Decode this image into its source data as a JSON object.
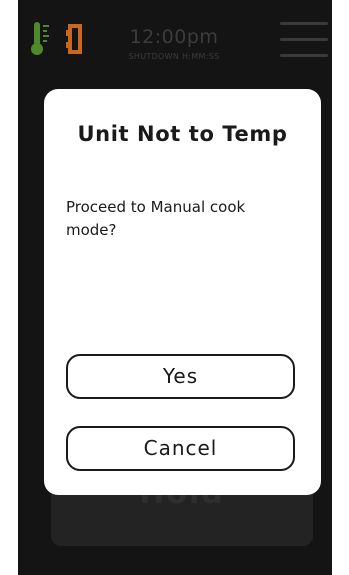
{
  "status_bar": {
    "time": "12:00pm",
    "shutdown_label": "SHUTDOWN H:MM:SS",
    "icons": {
      "temperature": "thermometer-icon",
      "door": "door-icon",
      "menu": "hamburger-menu-icon"
    }
  },
  "background_panel": {
    "label": "Hold"
  },
  "dialog": {
    "title": "Unit Not to Temp",
    "message": "Proceed to Manual cook mode?",
    "buttons": {
      "yes": "Yes",
      "cancel": "Cancel"
    }
  },
  "colors": {
    "screen_background": "#141414",
    "thermometer_green": "#4f8a2a",
    "door_orange": "#c8681f",
    "dialog_background": "#ffffff",
    "text": "#1a1a1a"
  }
}
